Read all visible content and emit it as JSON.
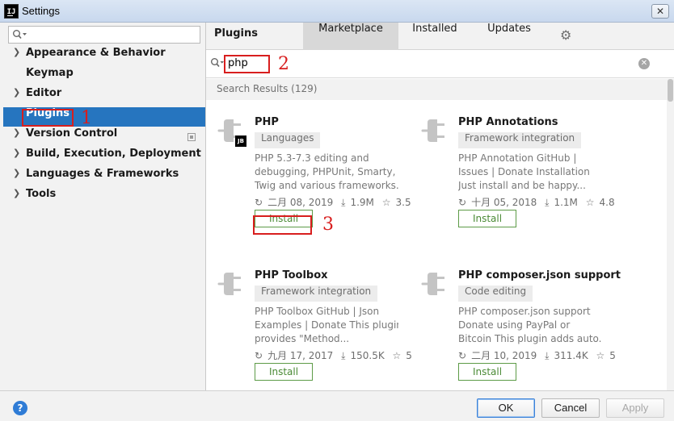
{
  "window": {
    "title": "Settings",
    "logo": "IJ",
    "close_glyph": "✕"
  },
  "sidebar": {
    "search_placeholder": "",
    "items": [
      {
        "label": "Appearance & Behavior",
        "expandable": true
      },
      {
        "label": "Keymap",
        "expandable": false
      },
      {
        "label": "Editor",
        "expandable": true
      },
      {
        "label": "Plugins",
        "expandable": false,
        "selected": true
      },
      {
        "label": "Version Control",
        "expandable": true,
        "project_icon": true
      },
      {
        "label": "Build, Execution, Deployment",
        "expandable": true
      },
      {
        "label": "Languages & Frameworks",
        "expandable": true
      },
      {
        "label": "Tools",
        "expandable": true
      }
    ]
  },
  "header": {
    "title": "Plugins",
    "tabs": [
      {
        "label": "Marketplace",
        "active": true
      },
      {
        "label": "Installed",
        "active": false
      },
      {
        "label": "Updates",
        "active": false
      }
    ],
    "gear_glyph": "⚙"
  },
  "search": {
    "query": "php",
    "clear_glyph": "✕"
  },
  "results": {
    "header": "Search Results (129)"
  },
  "plugins": [
    {
      "name": "PHP",
      "tag": "Languages",
      "jb_badge": "JB",
      "desc": [
        "PHP 5.3-7.3 editing and",
        "debugging, PHPUnit, Smarty,",
        "Twig and various frameworks..."
      ],
      "date": "二月 08, 2019",
      "downloads": "1.9M",
      "rating": "3.5",
      "install_label": "Install"
    },
    {
      "name": "PHP Annotations",
      "tag": "Framework integration",
      "desc": [
        "PHP Annotation GitHub |",
        "Issues | Donate Installation",
        "Just install and be happy..."
      ],
      "date": "十月 05, 2018",
      "downloads": "1.1M",
      "rating": "4.8",
      "install_label": "Install"
    },
    {
      "name": "PHP Toolbox",
      "tag": "Framework integration",
      "desc": [
        "PHP Toolbox GitHub | Json",
        "Examples | Donate This plugin",
        "provides \"Method..."
      ],
      "date": "九月 17, 2017",
      "downloads": "150.5K",
      "rating": "5",
      "install_label": "Install"
    },
    {
      "name": "PHP composer.json support",
      "tag": "Code editing",
      "desc": [
        "PHP composer.json support",
        "Donate using PayPal or",
        "Bitcoin This plugin adds auto..."
      ],
      "date": "二月 10, 2019",
      "downloads": "311.4K",
      "rating": "5",
      "install_label": "Install"
    }
  ],
  "annotations": [
    "1",
    "2",
    "3"
  ],
  "footer": {
    "help": "?",
    "ok": "OK",
    "cancel": "Cancel",
    "apply": "Apply"
  },
  "colors": {
    "selection": "#2675bf",
    "annotation": "#d81e1e",
    "install_green": "#4a8a35",
    "help_blue": "#2f7cd6"
  }
}
